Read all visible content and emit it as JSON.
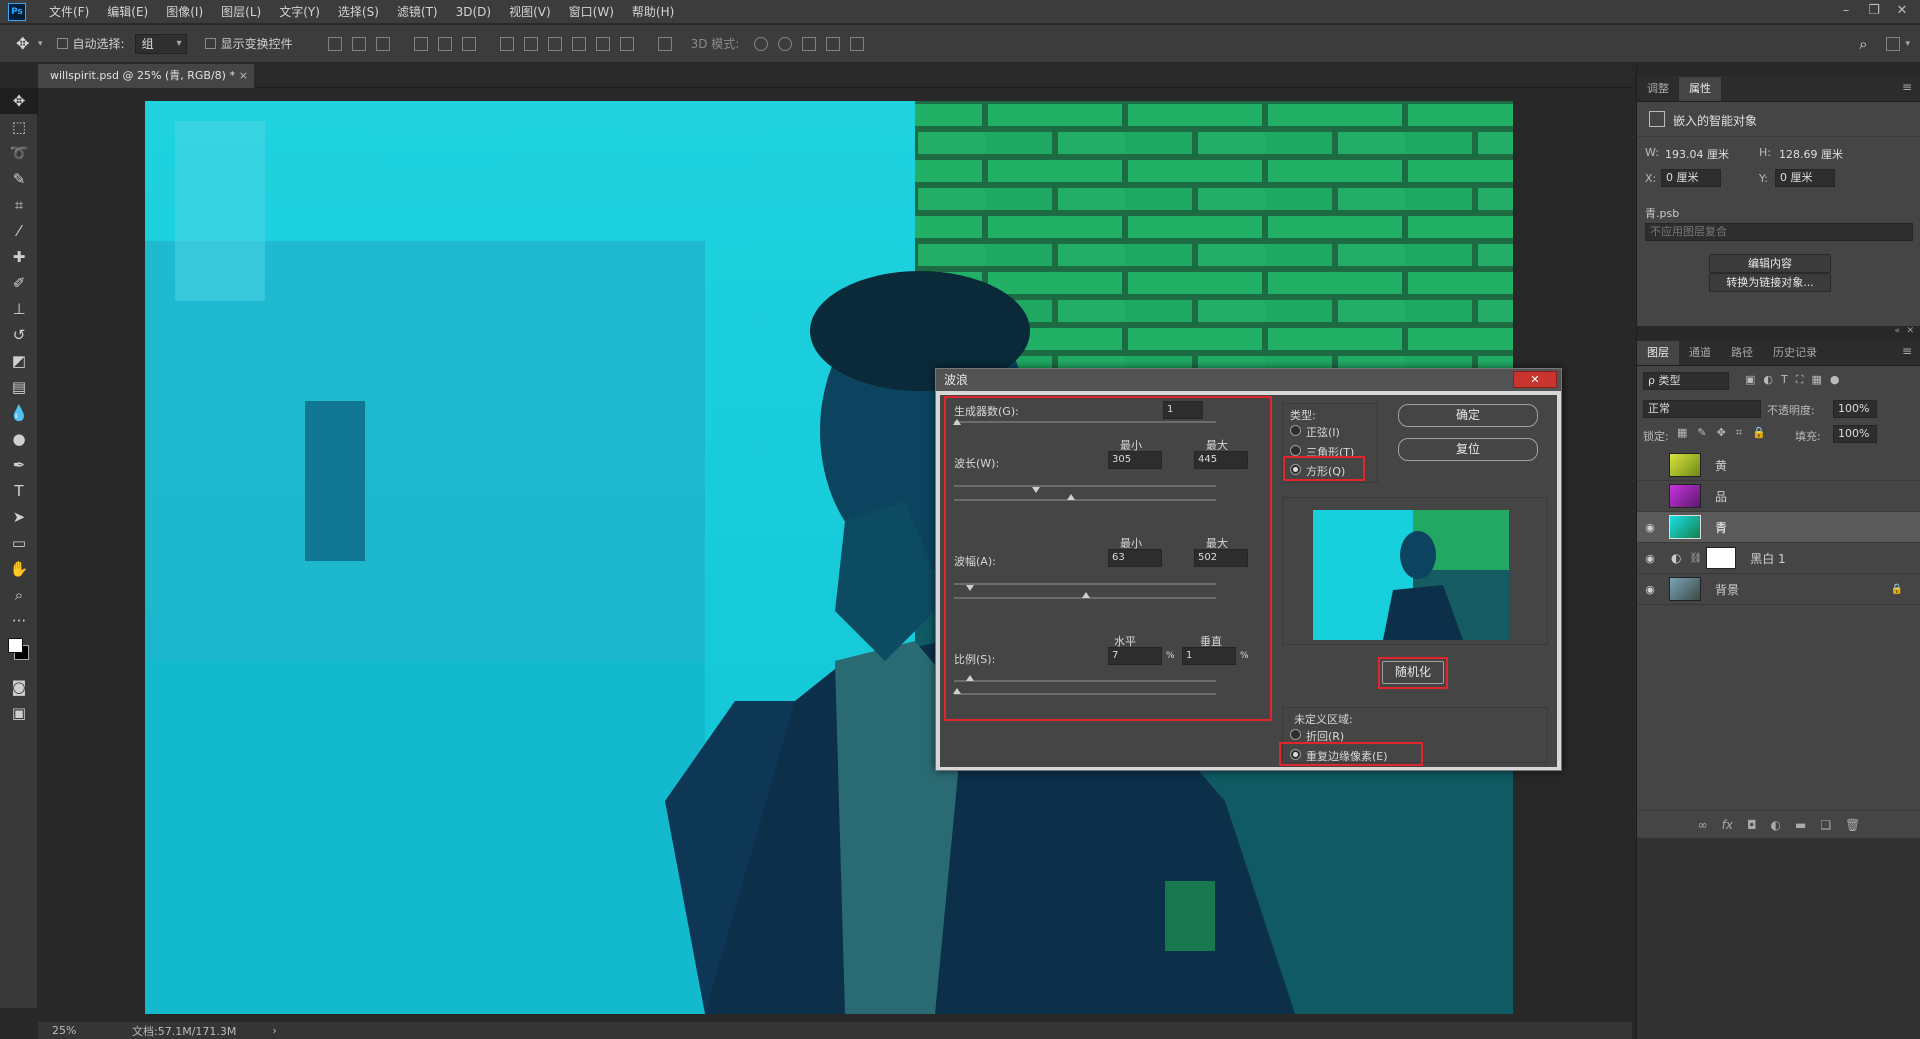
{
  "menu": {
    "logo": "Ps",
    "items": [
      "文件(F)",
      "编辑(E)",
      "图像(I)",
      "图层(L)",
      "文字(Y)",
      "选择(S)",
      "滤镜(T)",
      "3D(D)",
      "视图(V)",
      "窗口(W)",
      "帮助(H)"
    ]
  },
  "options": {
    "auto_select_label": "自动选择:",
    "auto_select_value": "组",
    "show_transform_label": "显示变换控件",
    "mode_3d_label": "3D 模式:"
  },
  "document": {
    "tab_title": "willspirit.psd @ 25% (青, RGB/8) *",
    "close_glyph": "×"
  },
  "status": {
    "zoom": "25%",
    "doc_size": "文档:57.1M/171.3M",
    "arrow": "›"
  },
  "properties_panel": {
    "tabs": [
      "调整",
      "属性"
    ],
    "heading": "嵌入的智能对象",
    "w_label": "W:",
    "w_value": "193.04 厘米",
    "h_label": "H:",
    "h_value": "128.69 厘米",
    "x_label": "X:",
    "x_value": "0 厘米",
    "y_label": "Y:",
    "y_value": "0 厘米",
    "file": "青.psb",
    "comp_select": "不应用图层复合",
    "edit_button": "编辑内容",
    "convert_button": "转换为链接对象..."
  },
  "layers_panel": {
    "tabs": [
      "图层",
      "通道",
      "路径",
      "历史记录"
    ],
    "filter": "ρ 类型",
    "blend_mode": "正常",
    "opacity_label": "不透明度:",
    "opacity_value": "100%",
    "lock_label": "锁定:",
    "fill_label": "填充:",
    "fill_value": "100%",
    "layers": [
      {
        "name": "黄",
        "visible": false,
        "selected": false
      },
      {
        "name": "品",
        "visible": false,
        "selected": false
      },
      {
        "name": "青",
        "visible": true,
        "selected": true
      },
      {
        "name": "黑白 1",
        "visible": true,
        "selected": false
      },
      {
        "name": "背景",
        "visible": true,
        "selected": false
      }
    ],
    "footer_icons": [
      "link-icon",
      "fx-icon",
      "mask-icon",
      "adjustment-icon",
      "folder-icon",
      "new-layer-icon",
      "trash-icon"
    ],
    "fx_text": "fx"
  },
  "wave_dialog": {
    "title": "波浪",
    "close_glyph": "✕",
    "generators_label": "生成器数(G):",
    "generators_value": "1",
    "min_label": "最小",
    "max_label": "最大",
    "wavelength_label": "波长(W):",
    "wavelength_min": "305",
    "wavelength_max": "445",
    "amplitude_label": "波幅(A):",
    "amplitude_min": "63",
    "amplitude_max": "502",
    "horizontal_label": "水平",
    "vertical_label": "垂直",
    "scale_label": "比例(S):",
    "scale_h": "7",
    "scale_v": "1",
    "percent": "%",
    "type_label": "类型:",
    "type_sine": "正弦(I)",
    "type_triangle": "三角形(T)",
    "type_square": "方形(Q)",
    "type_selected": "方形(Q)",
    "ok_button": "确定",
    "reset_button": "复位",
    "randomize_button": "随机化",
    "undefined_label": "未定义区域:",
    "wrap_option": "折回(R)",
    "repeat_option": "重复边缘像素(E)",
    "undefined_selected": "重复边缘像素(E)"
  },
  "colors": {
    "accent_blue": "#31a8ff",
    "annotation_red": "#e0262c",
    "cyan_photo": "#12dfe8",
    "green_wall": "#1fae62"
  }
}
